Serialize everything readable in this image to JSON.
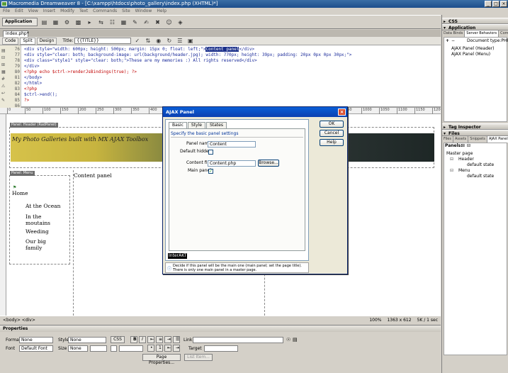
{
  "window": {
    "title": "Macromedia Dreamweaver 8 - [C:\\xampp\\htdocs\\photo_gallery\\index.php (XHTML)*]",
    "controls": [
      "_",
      "□",
      "×"
    ]
  },
  "menu": [
    "File",
    "Edit",
    "View",
    "Insert",
    "Modify",
    "Text",
    "Commands",
    "Site",
    "Window",
    "Help"
  ],
  "insertbar": {
    "category": "Application"
  },
  "document": {
    "tab": "index.php*",
    "view_code": "Code",
    "view_split": "Split",
    "view_design": "Design",
    "title_label": "Title:",
    "title_value": "{{TITLE}}"
  },
  "code": {
    "lines": [
      {
        "n": "76",
        "text": "<div style=\"width: 600px; height: 500px; margin: 15px 0; float: left;\">",
        "hl": "Content panel",
        "tail": "</div>"
      },
      {
        "n": "77",
        "text": "<div style=\"clear: both; background-image: url(background/header.jpg); width: 770px; height: 39px; padding: 20px 0px 0px 30px;\">"
      },
      {
        "n": "78",
        "text": "  <div class=\"style1\" style=\"clear: both;\">These are my memories :) All rights reserved</div>"
      },
      {
        "n": "79",
        "text": "</div>"
      },
      {
        "n": "80",
        "text": "<?php echo $ctrl->renderJsBindings(true); ?>",
        "php": true
      },
      {
        "n": "81",
        "text": "</body>"
      },
      {
        "n": "82",
        "text": "</html>"
      },
      {
        "n": "83",
        "text": "<?php",
        "php": true
      },
      {
        "n": "84",
        "text": "$ctrl->end();"
      },
      {
        "n": "85",
        "text": "?>",
        "php": true
      },
      {
        "n": "86",
        "text": ""
      }
    ]
  },
  "design": {
    "ruler_ticks": [
      "0",
      "50",
      "100",
      "150",
      "200",
      "250",
      "300",
      "350",
      "400",
      "450",
      "500",
      "550",
      "600",
      "650",
      "700",
      "750",
      "800",
      "850",
      "900",
      "950",
      "1000",
      "1050",
      "1100",
      "1150",
      "1200"
    ],
    "header_panel_tab": "Panel: Header (RadPanel)",
    "banner_text": "My Photo Galleries built with MX AJAX Toolbox",
    "menu_panel_tab": "Panel: Menu",
    "menu_items": [
      "Home",
      "At the Ocean",
      "In the moutains",
      "Weeding",
      "Our big family"
    ],
    "content_label": "Content panel"
  },
  "status": {
    "tags": "<body> <div>",
    "zoom": "100%",
    "size": "1363 x 612",
    "download": "5K / 1 sec"
  },
  "properties": {
    "title": "Properties",
    "format_label": "Format",
    "format_value": "None",
    "style_label": "Style",
    "style_value": "None",
    "css_btn": "CSS",
    "bold": "B",
    "italic": "I",
    "link_label": "Link",
    "font_label": "Font",
    "font_value": "Default Font",
    "size_label": "Size",
    "size_value": "None",
    "target_label": "Target",
    "page_props": "Page Properties...",
    "list_item": "List Item..."
  },
  "right_panel": {
    "css": "CSS",
    "application": "Application",
    "app_tabs": [
      "Data Binds",
      "Server Behaviors",
      "Comp"
    ],
    "doc_type": "Document type:PHP",
    "behaviors": [
      "AJAX Panel (Header)",
      "AJAX Panel (Menu)"
    ],
    "tag_inspector": "Tag Inspector",
    "files": "Files",
    "files_tabs": [
      "Files",
      "Assets",
      "Snippets",
      "AJAX Panels"
    ],
    "panels_label": "Panels:",
    "tree": [
      "Master page",
      "Header",
      "default state",
      "Menu",
      "default state"
    ]
  },
  "dialog": {
    "title": "AJAX Panel",
    "tabs": [
      "Basic",
      "Style",
      "States"
    ],
    "section": "Specify the basic panel settings",
    "panel_name_label": "Panel name:",
    "panel_name_value": "Content",
    "default_hidden_label": "Default hidden:",
    "content_file_label": "Content file:",
    "content_file_value": "Content.php",
    "browse": "Browse...",
    "main_panel_label": "Main panel:",
    "ok": "OK",
    "cancel": "Cancel",
    "help": "Help",
    "brand": "InterAKT",
    "help_text": "Decide if this panel will be the main one (main panel; set the page title). There is only one main panel in a master page."
  }
}
